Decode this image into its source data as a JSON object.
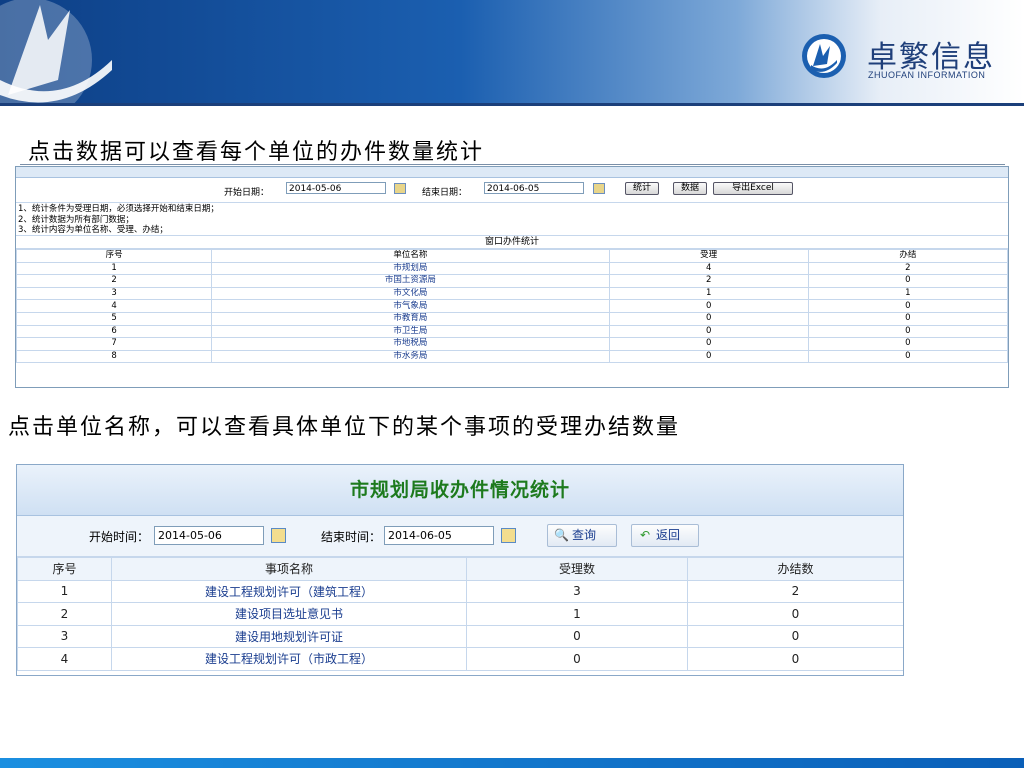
{
  "header": {
    "brand_cn": "卓繁信息",
    "brand_en": "ZHUOFAN INFORMATION"
  },
  "caption1": "点击数据可以查看每个单位的办件数量统计",
  "caption2": "点击单位名称，可以查看具体单位下的某个事项的受理办结数量",
  "s1": {
    "start_label": "开始日期：",
    "start_value": "2014-05-06",
    "end_label": "结束日期：",
    "end_value": "2014-06-05",
    "btn_stat": "统计",
    "btn_data": "数据",
    "btn_export": "导出Excel",
    "notes": [
      "1、统计条件为受理日期，必须选择开始和结束日期；",
      "2、统计数据为所有部门数据；",
      "3、统计内容为单位名称、受理、办结；"
    ],
    "table_title": "窗口办件统计",
    "columns": [
      "序号",
      "单位名称",
      "受理",
      "办结"
    ],
    "rows": [
      [
        "1",
        "市规划局",
        "4",
        "2"
      ],
      [
        "2",
        "市国土资源局",
        "2",
        "0"
      ],
      [
        "3",
        "市文化局",
        "1",
        "1"
      ],
      [
        "4",
        "市气象局",
        "0",
        "0"
      ],
      [
        "5",
        "市教育局",
        "0",
        "0"
      ],
      [
        "6",
        "市卫生局",
        "0",
        "0"
      ],
      [
        "7",
        "市地税局",
        "0",
        "0"
      ],
      [
        "8",
        "市水务局",
        "0",
        "0"
      ]
    ]
  },
  "s2": {
    "title": "市规划局收办件情况统计",
    "start_label": "开始时间：",
    "start_value": "2014-05-06",
    "end_label": "结束时间：",
    "end_value": "2014-06-05",
    "btn_query": "查询",
    "btn_back": "返回",
    "columns": [
      "序号",
      "事项名称",
      "受理数",
      "办结数"
    ],
    "rows": [
      [
        "1",
        "建设工程规划许可（建筑工程）",
        "3",
        "2"
      ],
      [
        "2",
        "建设项目选址意见书",
        "1",
        "0"
      ],
      [
        "3",
        "建设用地规划许可证",
        "0",
        "0"
      ],
      [
        "4",
        "建设工程规划许可（市政工程）",
        "0",
        "0"
      ]
    ]
  }
}
